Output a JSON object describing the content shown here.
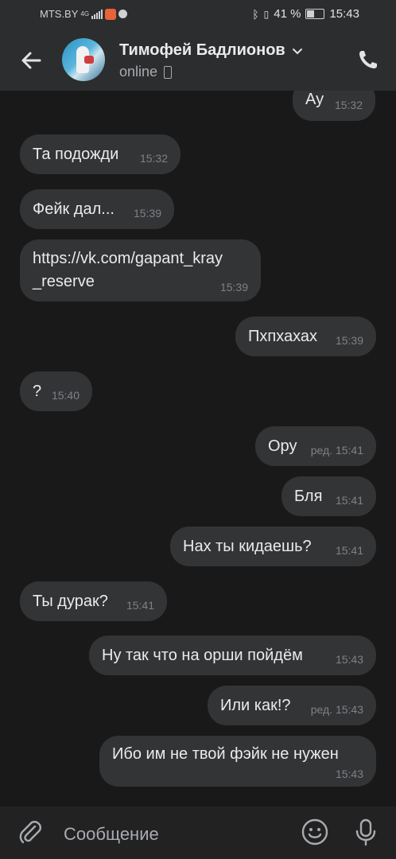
{
  "status": {
    "carrier": "MTS.BY",
    "network": "4G",
    "battery": "41 %",
    "battery_level": 0.41,
    "time": "15:43"
  },
  "header": {
    "name": "Тимофей Бадлионов",
    "status": "online"
  },
  "messages": [
    {
      "side": "out",
      "text": "Ау",
      "time": "15:32"
    },
    {
      "side": "in",
      "text": "Та подожди",
      "time": "15:32"
    },
    {
      "side": "in",
      "text": "Фейк дал...",
      "time": "15:39"
    },
    {
      "side": "in",
      "link_line1": "https://vk.com/gapant_kray",
      "link_line2": "_reserve",
      "time": "15:39"
    },
    {
      "side": "out",
      "text": "Пхпхахах",
      "time": "15:39"
    },
    {
      "side": "in",
      "text": "?",
      "time": "15:40"
    },
    {
      "side": "out",
      "text": "Ору",
      "edited": "ред.",
      "time": "15:41"
    },
    {
      "side": "out",
      "text": "Бля",
      "time": "15:41"
    },
    {
      "side": "out",
      "text": "Нах ты кидаешь?",
      "time": "15:41"
    },
    {
      "side": "in",
      "text": "Ты дурак?",
      "time": "15:41"
    },
    {
      "side": "out",
      "text": "Ну так что на орши пойдём",
      "time": "15:43"
    },
    {
      "side": "out",
      "text": "Или как!?",
      "edited": "ред.",
      "time": "15:43"
    },
    {
      "side": "out",
      "text": "Ибо им не твой фэйк не нужен",
      "time": "15:43"
    }
  ],
  "composer": {
    "placeholder": "Сообщение"
  },
  "icons": {
    "back": "back-arrow-icon",
    "call": "phone-icon",
    "attach": "paperclip-icon",
    "emoji": "smile-icon",
    "mic": "microphone-icon"
  }
}
